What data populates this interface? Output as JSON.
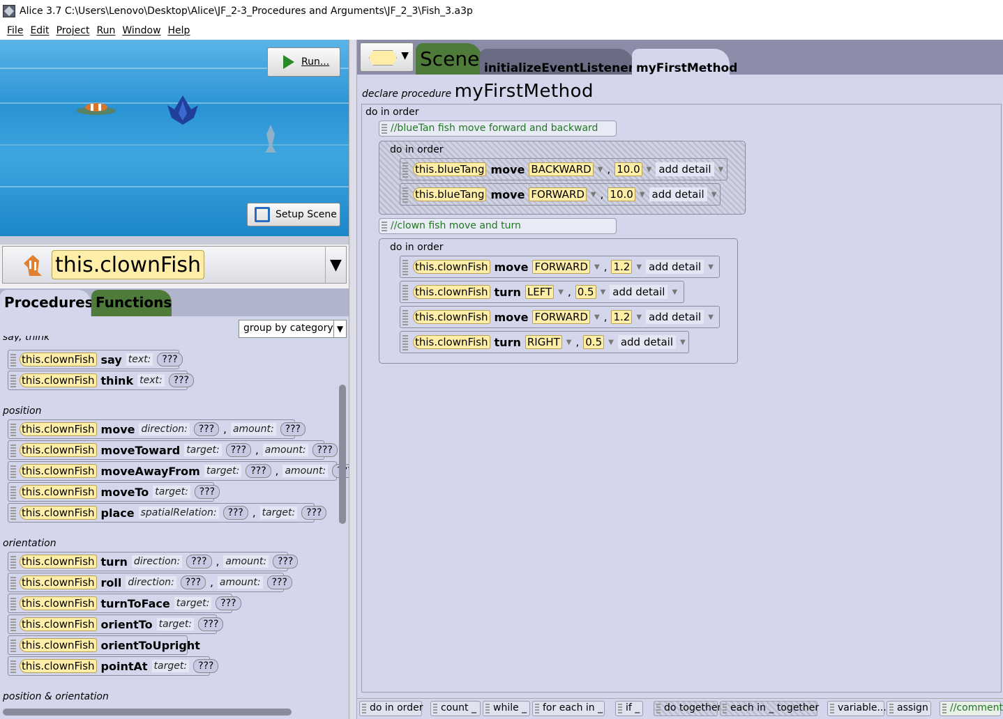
{
  "window": {
    "title": "Alice 3.7 C:\\Users\\Lenovo\\Desktop\\Alice\\JF_2-3_Procedures and Arguments\\JF_2_3\\Fish_3.a3p"
  },
  "menu": [
    "File",
    "Edit",
    "Project",
    "Run",
    "Window",
    "Help"
  ],
  "scene_view": {
    "run_label": "Run...",
    "setup_label": "Setup Scene"
  },
  "selector": {
    "object": "this.clownFish"
  },
  "left_tabs": {
    "procedures": "Procedures",
    "functions": "Functions"
  },
  "palette": {
    "group_by": "group by category",
    "categories": {
      "say_think": "say, think",
      "position": "position",
      "orientation": "orientation",
      "pos_orient": "position & orientation"
    },
    "obj": "this.clownFish",
    "q": "???",
    "say": {
      "name": "say",
      "p1": "text:"
    },
    "think": {
      "name": "think",
      "p1": "text:"
    },
    "move": {
      "name": "move",
      "p1": "direction:",
      "p2": "amount:"
    },
    "moveToward": {
      "name": "moveToward",
      "p1": "target:",
      "p2": "amount:"
    },
    "moveAwayFrom": {
      "name": "moveAwayFrom",
      "p1": "target:",
      "p2": "amount:"
    },
    "moveTo": {
      "name": "moveTo",
      "p1": "target:"
    },
    "place": {
      "name": "place",
      "p1": "spatialRelation:",
      "p2": "target:"
    },
    "turn": {
      "name": "turn",
      "p1": "direction:",
      "p2": "amount:"
    },
    "roll": {
      "name": "roll",
      "p1": "direction:",
      "p2": "amount:"
    },
    "turnToFace": {
      "name": "turnToFace",
      "p1": "target:"
    },
    "orientTo": {
      "name": "orientTo",
      "p1": "target:"
    },
    "orientToUpright": {
      "name": "orientToUpright"
    },
    "pointAt": {
      "name": "pointAt",
      "p1": "target:"
    }
  },
  "editor_tabs": {
    "scene": "Scene",
    "init": "initializeEventListeners",
    "method": "myFirstMethod"
  },
  "declaration": {
    "prefix": "declare procedure",
    "name": "myFirstMethod"
  },
  "code": {
    "do_in_order": "do in order",
    "comment1": "//blueTan fish move forward and backward",
    "comment2": "//clown fish move and turn",
    "add_detail": "add detail",
    "bt1": {
      "obj": "this.blueTang",
      "method": "move",
      "dir": "BACKWARD",
      "amt": "10.0"
    },
    "bt2": {
      "obj": "this.blueTang",
      "method": "move",
      "dir": "FORWARD",
      "amt": "10.0"
    },
    "cf1": {
      "obj": "this.clownFish",
      "method": "move",
      "dir": "FORWARD",
      "amt": "1.2"
    },
    "cf2": {
      "obj": "this.clownFish",
      "method": "turn",
      "dir": "LEFT",
      "amt": "0.5"
    },
    "cf3": {
      "obj": "this.clownFish",
      "method": "move",
      "dir": "FORWARD",
      "amt": "1.2"
    },
    "cf4": {
      "obj": "this.clownFish",
      "method": "turn",
      "dir": "RIGHT",
      "amt": "0.5"
    }
  },
  "control_bar": [
    "do in order",
    "count _",
    "while _",
    "for each in _",
    "if _",
    "do together",
    "each in _ together",
    "variable...",
    "assign",
    "//comment"
  ]
}
